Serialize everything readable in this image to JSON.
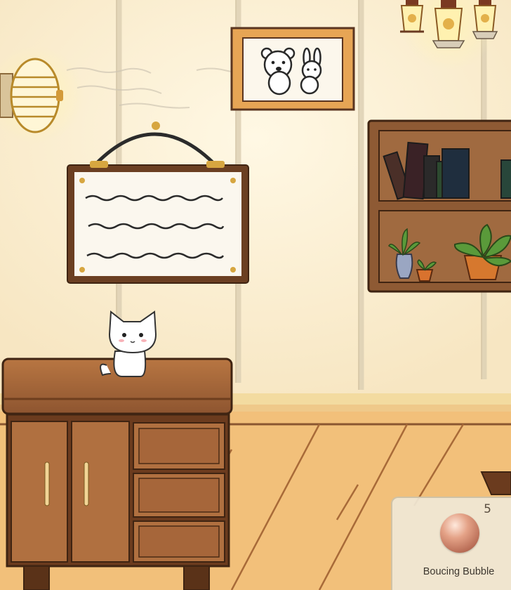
{
  "inventory": {
    "item_name": "Boucing Bubble",
    "item_count": "5",
    "item_icon": "bubble-orb-icon"
  },
  "scene": {
    "character": "white-cat",
    "colors": {
      "wall": "#fbeed0",
      "floor": "#f2c07a",
      "wood_dark": "#5a3520",
      "wood_mid": "#a9663a"
    }
  }
}
